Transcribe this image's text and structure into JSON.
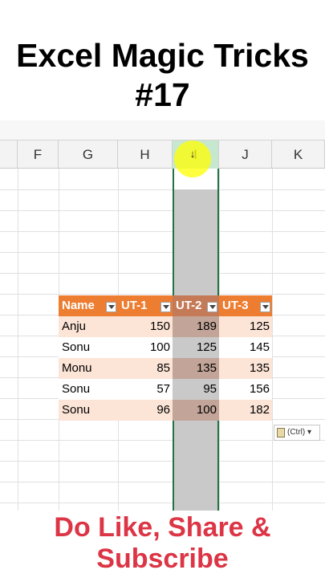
{
  "title": {
    "line1": "Excel Magic Tricks",
    "line2": "#17"
  },
  "spreadsheet": {
    "columns": [
      "F",
      "G",
      "H",
      "I",
      "J",
      "K"
    ],
    "selected_column": "I",
    "table": {
      "headers": [
        "Name",
        "UT-1",
        "UT-2",
        "UT-3"
      ],
      "rows": [
        [
          "Anju",
          "150",
          "189",
          "125"
        ],
        [
          "Sonu",
          "100",
          "125",
          "145"
        ],
        [
          "Monu",
          "85",
          "135",
          "135"
        ],
        [
          "Sonu",
          "57",
          "95",
          "156"
        ],
        [
          "Sonu",
          "96",
          "100",
          "182"
        ]
      ]
    },
    "paste_options_label": "(Ctrl)",
    "paste_options_arrow": "▾",
    "cursor_glyph": "↓"
  },
  "caption": {
    "line1": "Do Like, Share &",
    "line2": "Subscribe"
  },
  "colors": {
    "header_orange": "#ed7d31",
    "band_row": "#fce4d6",
    "selection_green": "#217346",
    "caption_red": "#dc3545"
  }
}
